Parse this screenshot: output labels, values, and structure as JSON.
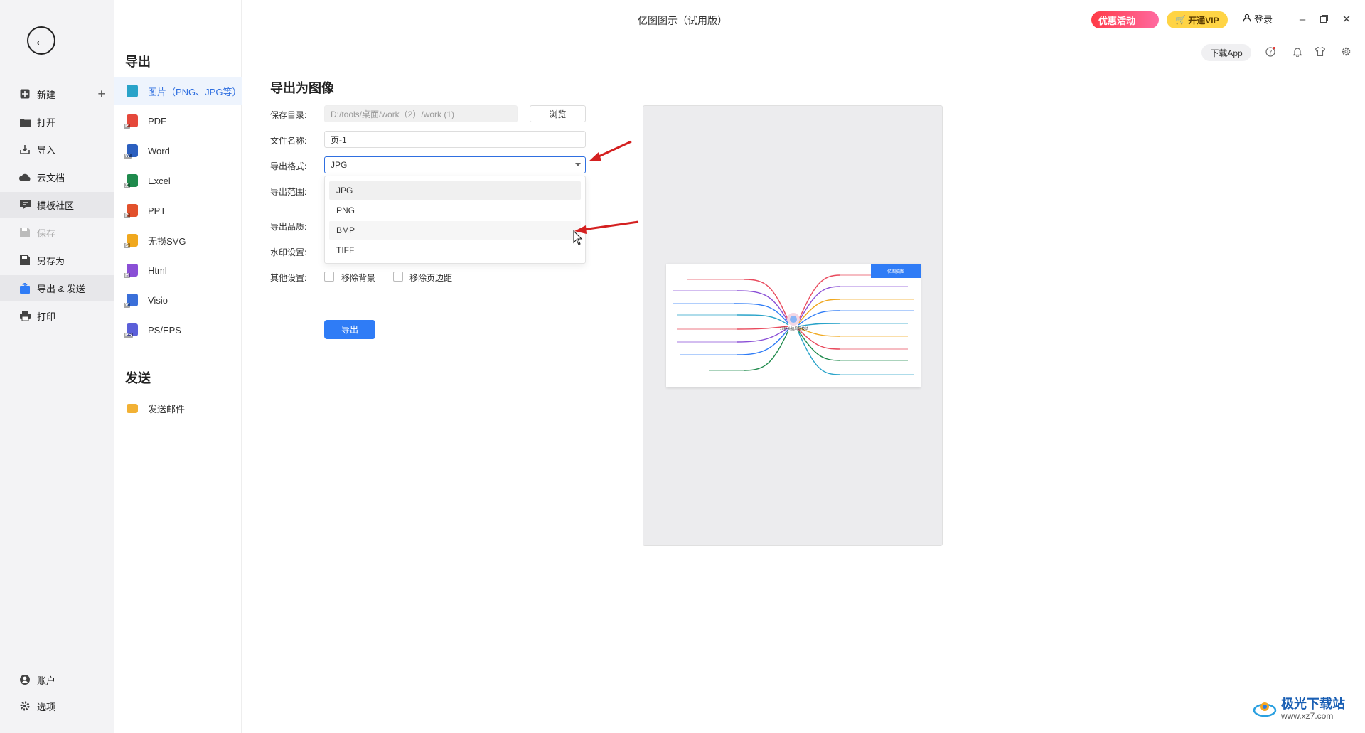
{
  "window": {
    "title": "亿图图示（试用版）",
    "promo_label": "优惠活动",
    "vip_label": "开通VIP",
    "login_label": "登录",
    "download_app_label": "下载App"
  },
  "rail": {
    "items": [
      {
        "label": "新建",
        "icon": "plus-square-icon"
      },
      {
        "label": "打开",
        "icon": "folder-icon"
      },
      {
        "label": "导入",
        "icon": "import-icon"
      },
      {
        "label": "云文档",
        "icon": "cloud-icon"
      },
      {
        "label": "模板社区",
        "icon": "community-icon"
      },
      {
        "label": "保存",
        "icon": "save-icon"
      },
      {
        "label": "另存为",
        "icon": "save-as-icon"
      },
      {
        "label": "导出 & 发送",
        "icon": "export-icon"
      },
      {
        "label": "打印",
        "icon": "printer-icon"
      }
    ],
    "bottom": [
      {
        "label": "账户",
        "icon": "user-icon"
      },
      {
        "label": "选项",
        "icon": "gear-icon"
      }
    ]
  },
  "submenu": {
    "export_heading": "导出",
    "send_heading": "发送",
    "export_items": [
      {
        "label": "图片（PNG、JPG等）",
        "color": "#29a3c9",
        "badge": "IMG"
      },
      {
        "label": "PDF",
        "color": "#e5483b",
        "badge": "P"
      },
      {
        "label": "Word",
        "color": "#2b5fbf",
        "badge": "W"
      },
      {
        "label": "Excel",
        "color": "#1f8a4c",
        "badge": "X"
      },
      {
        "label": "PPT",
        "color": "#e2512c",
        "badge": "P"
      },
      {
        "label": "无损SVG",
        "color": "#f0a81e",
        "badge": "S"
      },
      {
        "label": "Html",
        "color": "#8a4fd6",
        "badge": "H"
      },
      {
        "label": "Visio",
        "color": "#3a6fd9",
        "badge": "V"
      },
      {
        "label": "PS/EPS",
        "color": "#5b5fd9",
        "badge": "PS"
      }
    ],
    "send_items": [
      {
        "label": "发送邮件",
        "color": "#f2b134"
      }
    ]
  },
  "form": {
    "title": "导出为图像",
    "save_dir_label": "保存目录:",
    "save_dir_value": "D:/tools/桌面/work（2）/work (1)",
    "browse_label": "浏览",
    "file_name_label": "文件名称:",
    "file_name_value": "页-1",
    "format_label": "导出格式:",
    "format_value": "JPG",
    "format_options": [
      "JPG",
      "PNG",
      "BMP",
      "TIFF"
    ],
    "range_label": "导出范围:",
    "quality_label": "导出品质:",
    "watermark_label": "水印设置:",
    "other_label": "其他设置:",
    "remove_bg_label": "移除背景",
    "remove_margin_label": "移除页边距",
    "export_button": "导出"
  },
  "preview": {
    "center_text": "17种头脑风暴技法",
    "tag_text": "亿图脑图"
  },
  "watermark": {
    "brand": "极光下载站",
    "url": "www.xz7.com"
  },
  "colors": {
    "accent": "#2f7cf6",
    "arrow": "#d42020"
  }
}
